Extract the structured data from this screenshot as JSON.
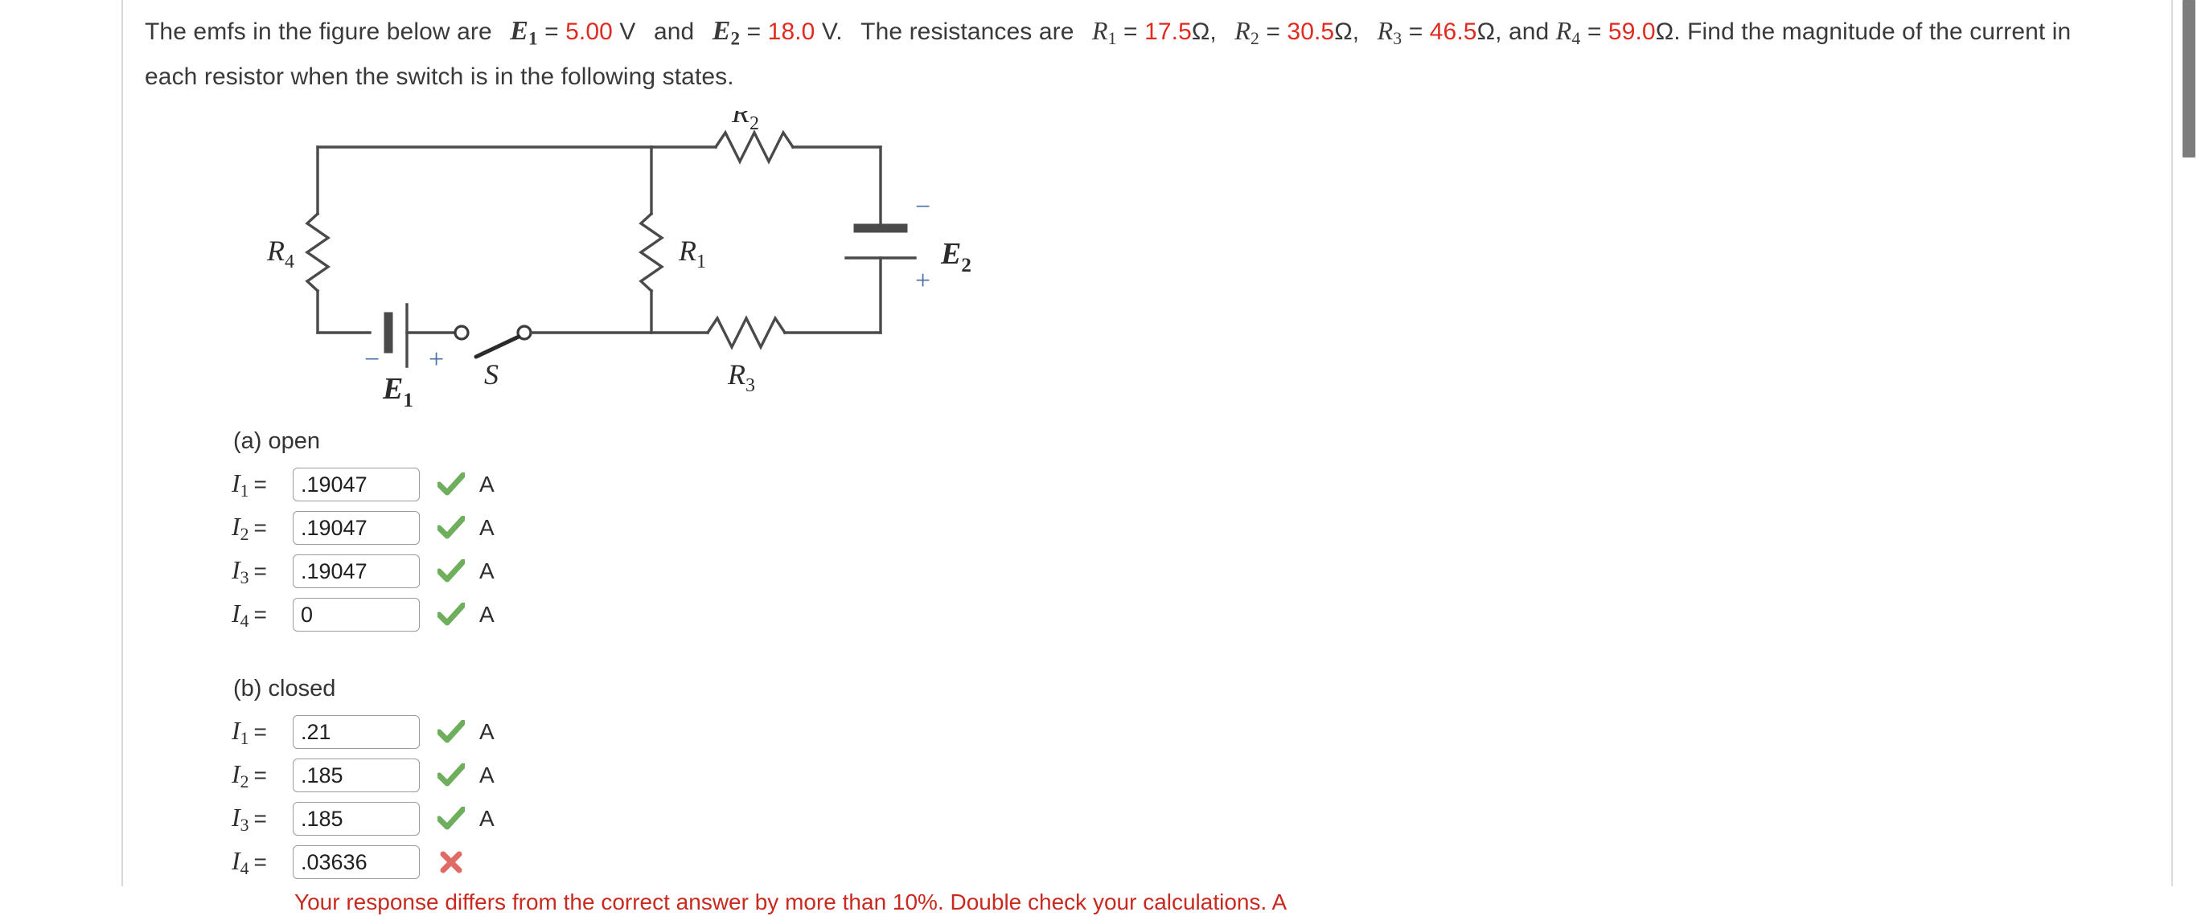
{
  "problem": {
    "text_1": "The emfs in the figure below are",
    "emf1_symbol": "E",
    "emf1_sub": "1",
    "eq_1": "=",
    "emf1_value": "5.00",
    "unit_v1": "V",
    "and_1": "and",
    "emf2_symbol": "E",
    "emf2_sub": "2",
    "eq_2": "=",
    "emf2_value": "18.0",
    "unit_v2": "V.",
    "text_2": "The resistances are",
    "r1_symbol": "R",
    "r1_sub": "1",
    "r1_value": "17.5",
    "r1_unit": "Ω,",
    "r2_symbol": "R",
    "r2_sub": "2",
    "r2_value": "30.5",
    "r2_unit": "Ω,",
    "r3_symbol": "R",
    "r3_sub": "3",
    "r3_value": "46.5",
    "r3_unit": "Ω,",
    "and_2": "and",
    "r4_symbol": "R",
    "r4_sub": "4",
    "r4_value": "59.0",
    "r4_unit": "Ω.",
    "text_3": "Find the magnitude of the current in each resistor when the switch is in the following states."
  },
  "figure": {
    "label_r1": "R",
    "label_r1_sub": "1",
    "label_r2": "R",
    "label_r2_sub": "2",
    "label_r3": "R",
    "label_r3_sub": "3",
    "label_r4": "R",
    "label_r4_sub": "4",
    "label_emf1": "E",
    "label_emf1_sub": "1",
    "label_emf2": "E",
    "label_emf2_sub": "2",
    "label_switch": "S",
    "emf1_minus": "−",
    "emf1_plus": "+",
    "emf2_minus": "−",
    "emf2_plus": "+",
    "label_color": "#2b2b2b",
    "wire_color": "#4a4a4a"
  },
  "colors": {
    "value_red": "#e02b20",
    "error_red": "#c9291f",
    "check_green": "#6fae5c",
    "cross_red": "#e06a66",
    "input_border": "#9b9b9b"
  },
  "sections": [
    {
      "title": "(a) open",
      "rows": [
        {
          "label": "I",
          "sub": "1",
          "eq": "=",
          "value": ".19047",
          "status": "correct",
          "unit": "A"
        },
        {
          "label": "I",
          "sub": "2",
          "eq": "=",
          "value": ".19047",
          "status": "correct",
          "unit": "A"
        },
        {
          "label": "I",
          "sub": "3",
          "eq": "=",
          "value": ".19047",
          "status": "correct",
          "unit": "A"
        },
        {
          "label": "I",
          "sub": "4",
          "eq": "=",
          "value": "0",
          "status": "correct",
          "unit": "A"
        }
      ]
    },
    {
      "title": "(b) closed",
      "rows": [
        {
          "label": "I",
          "sub": "1",
          "eq": "=",
          "value": ".21",
          "status": "correct",
          "unit": "A"
        },
        {
          "label": "I",
          "sub": "2",
          "eq": "=",
          "value": ".185",
          "status": "correct",
          "unit": "A"
        },
        {
          "label": "I",
          "sub": "3",
          "eq": "=",
          "value": ".185",
          "status": "correct",
          "unit": "A"
        },
        {
          "label": "I",
          "sub": "4",
          "eq": "=",
          "value": ".03636",
          "status": "incorrect",
          "unit": ""
        }
      ],
      "feedback": "Your response differs from the correct answer by more than 10%. Double check your calculations. A"
    }
  ]
}
